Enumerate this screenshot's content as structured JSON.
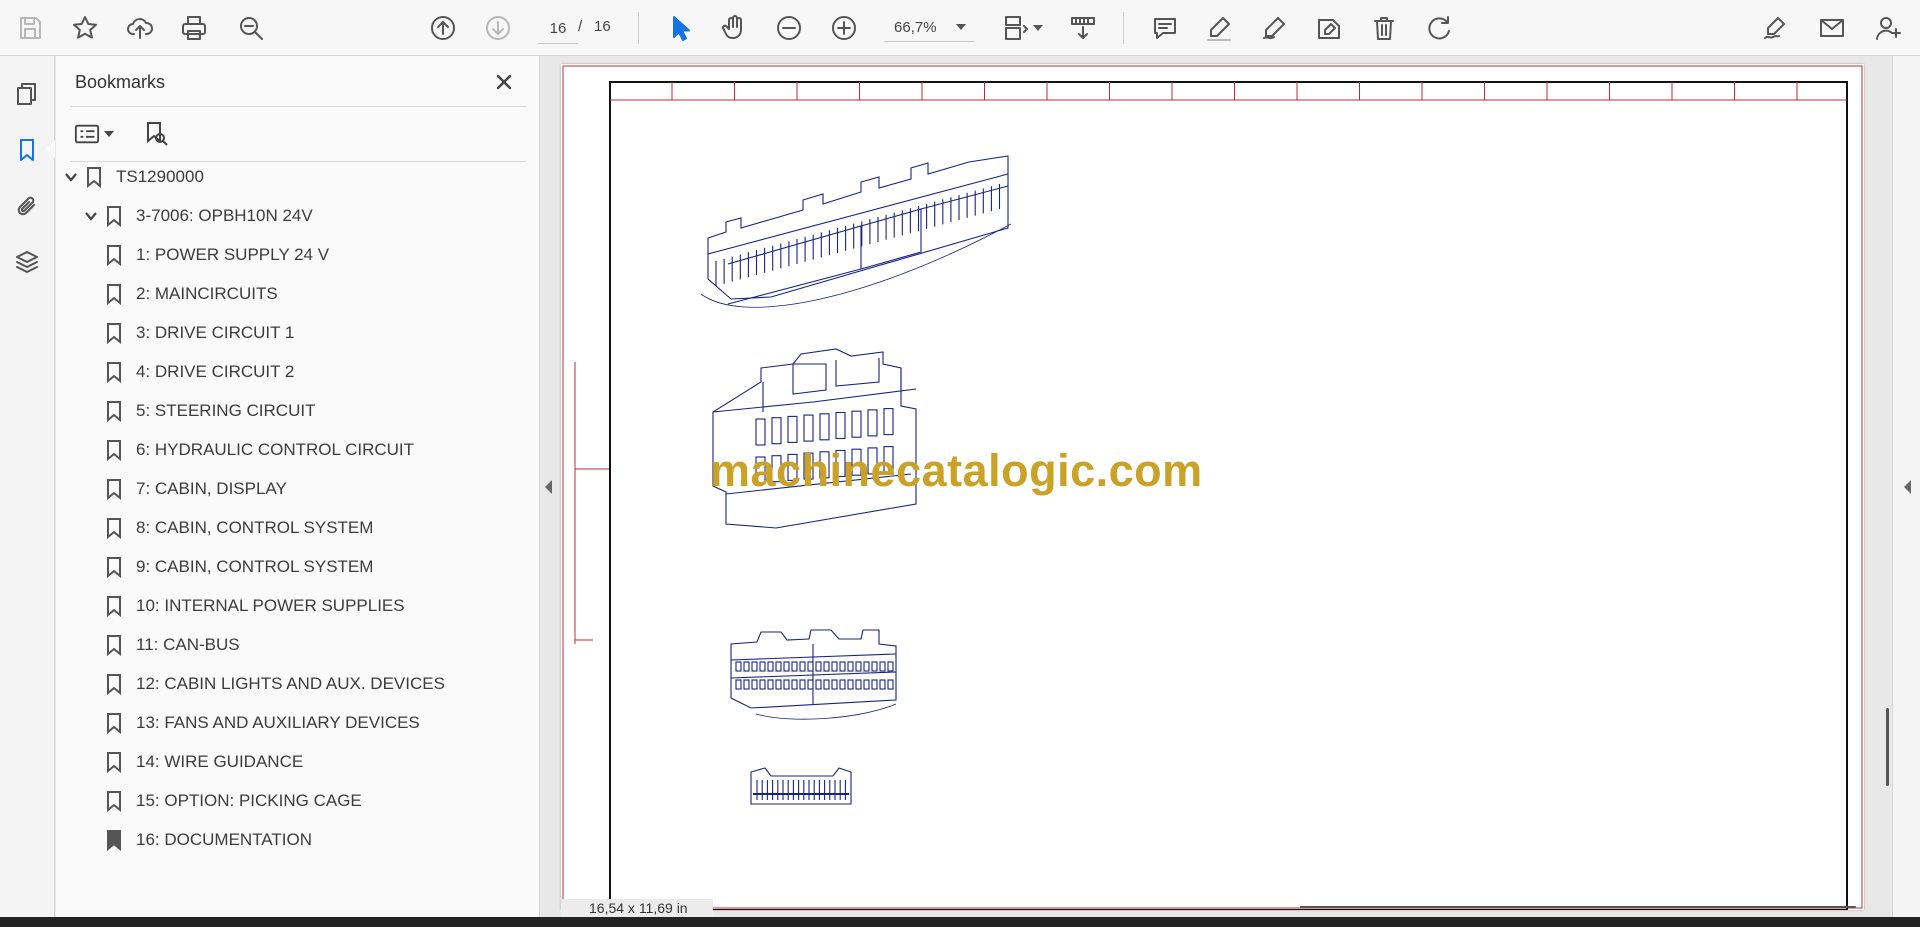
{
  "toolbar": {
    "current_page": "16",
    "page_separator": "/",
    "total_pages": "16",
    "zoom": "66,7%"
  },
  "bookmarks_panel": {
    "title": "Bookmarks",
    "items": [
      {
        "label": "TS1290000",
        "level": 0,
        "expanded": true
      },
      {
        "label": "3-7006: OPBH10N 24V",
        "level": 1,
        "expanded": true
      },
      {
        "label": "1: POWER SUPPLY 24 V",
        "level": 2
      },
      {
        "label": "2: MAINCIRCUITS",
        "level": 2
      },
      {
        "label": "3: DRIVE CIRCUIT 1",
        "level": 2
      },
      {
        "label": "4: DRIVE CIRCUIT 2",
        "level": 2
      },
      {
        "label": "5: STEERING CIRCUIT",
        "level": 2
      },
      {
        "label": "6: HYDRAULIC CONTROL CIRCUIT",
        "level": 2
      },
      {
        "label": "7: CABIN, DISPLAY",
        "level": 2
      },
      {
        "label": "8: CABIN, CONTROL SYSTEM",
        "level": 2
      },
      {
        "label": "9: CABIN, CONTROL SYSTEM",
        "level": 2
      },
      {
        "label": "10: INTERNAL POWER SUPPLIES",
        "level": 2
      },
      {
        "label": "11: CAN-BUS",
        "level": 2
      },
      {
        "label": "12: CABIN LIGHTS AND AUX. DEVICES",
        "level": 2
      },
      {
        "label": "13: FANS AND AUXILIARY DEVICES",
        "level": 2
      },
      {
        "label": "14: WIRE GUIDANCE",
        "level": 2
      },
      {
        "label": "15: OPTION: PICKING CAGE",
        "level": 2
      },
      {
        "label": "16: DOCUMENTATION",
        "level": 2,
        "current": true
      }
    ]
  },
  "document": {
    "watermark": "machinecatalogic.com",
    "page_size": "16,54 x 11,69 in"
  },
  "colors": {
    "accent": "#1473e6",
    "watermark": "#c9a227",
    "drawing_line": "#1a237e",
    "frame_red": "#c0283a"
  }
}
